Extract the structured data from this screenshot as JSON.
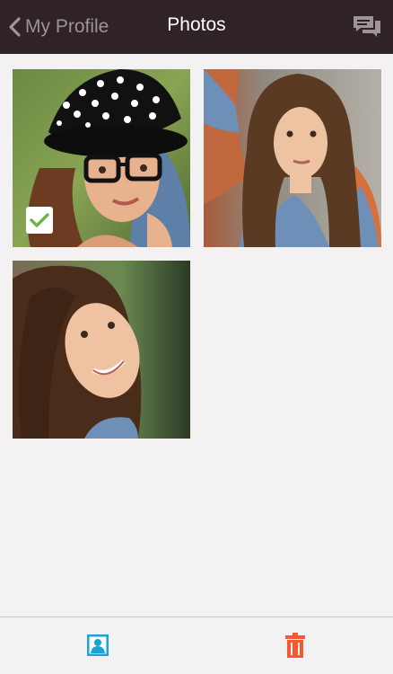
{
  "header": {
    "back_label": "My Profile",
    "title": "Photos",
    "chat_icon": "chat-bubbles-icon"
  },
  "photos": [
    {
      "selected": true
    },
    {
      "selected": false
    },
    {
      "selected": false
    }
  ],
  "toolbar": {
    "profile_icon": "profile-photo-icon",
    "trash_icon": "trash-icon"
  },
  "colors": {
    "header_bg": "#2f2326",
    "accent_blue": "#1aa4d6",
    "accent_red": "#f25a35",
    "check_green": "#6ab547"
  }
}
